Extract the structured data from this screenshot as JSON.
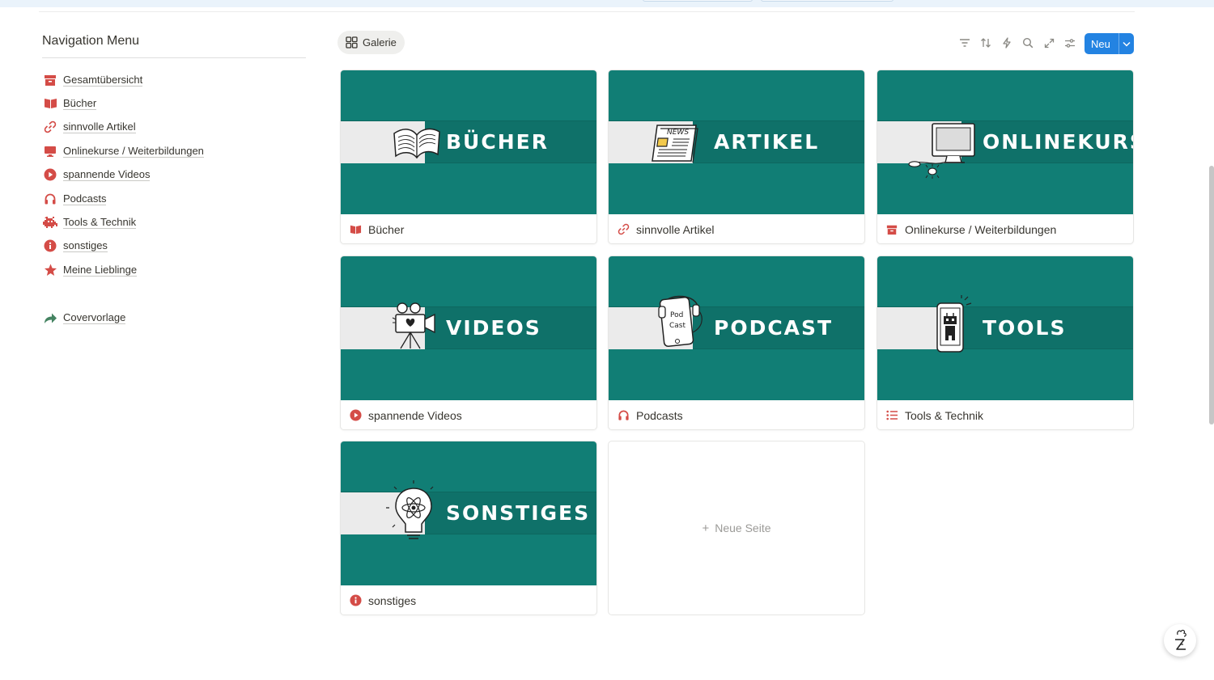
{
  "sidebar": {
    "title": "Navigation Menu",
    "items": [
      {
        "label": "Gesamtübersicht",
        "icon": "archive-box-icon",
        "color": "#d44c47"
      },
      {
        "label": "Bücher",
        "icon": "open-book-icon",
        "color": "#d44c47"
      },
      {
        "label": "sinnvolle Artikel",
        "icon": "link-icon",
        "color": "#d44c47"
      },
      {
        "label": "Onlinekurse / Weiterbildungen",
        "icon": "monitor-icon",
        "color": "#d44c47"
      },
      {
        "label": "spannende Videos",
        "icon": "play-circle-icon",
        "color": "#d44c47"
      },
      {
        "label": "Podcasts",
        "icon": "headphones-icon",
        "color": "#d44c47"
      },
      {
        "label": "Tools & Technik",
        "icon": "space-invader-icon",
        "color": "#d44c47"
      },
      {
        "label": "sonstiges",
        "icon": "info-circle-icon",
        "color": "#d44c47"
      },
      {
        "label": "Meine Lieblinge",
        "icon": "star-icon",
        "color": "#d44c47"
      }
    ],
    "extra": {
      "label": "Covervorlage",
      "icon": "share-arrow-icon",
      "color": "#448361"
    }
  },
  "toolbar": {
    "view_label": "Galerie",
    "new_label": "Neu",
    "accent": "#2383e2"
  },
  "gallery": {
    "cover_color": "#117e75",
    "cards": [
      {
        "cover_word": "BÜCHER",
        "caption": "Bücher",
        "icon": "open-book-icon"
      },
      {
        "cover_word": "ARTIKEL",
        "caption": "sinnvolle Artikel",
        "icon": "link-icon",
        "art_text": "NEWS"
      },
      {
        "cover_word": "ONLINEKURS",
        "caption": "Onlinekurse / Weiterbildungen",
        "icon": "archive-box-icon"
      },
      {
        "cover_word": "VIDEOS",
        "caption": "spannende Videos",
        "icon": "play-circle-icon"
      },
      {
        "cover_word": "PODCAST",
        "caption": "Podcasts",
        "icon": "headphones-icon",
        "art_text_1": "Pod",
        "art_text_2": "Cast"
      },
      {
        "cover_word": "TOOLS",
        "caption": "Tools & Technik",
        "icon": "list-icon"
      },
      {
        "cover_word": "SONSTIGES",
        "caption": "sonstiges",
        "icon": "info-circle-icon"
      }
    ],
    "new_page_label": "Neue Seite"
  }
}
